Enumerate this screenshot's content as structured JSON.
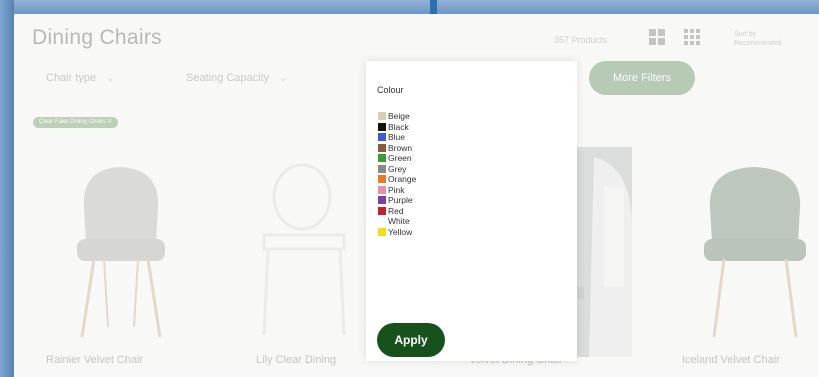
{
  "page": {
    "title": "Dining Chairs",
    "product_count": "357 Products",
    "sort_label": "Sort by Recommended"
  },
  "filters": {
    "chair_type": "Chair type",
    "seating_capacity": "Seating Capacity",
    "more_filters": "More Filters",
    "clear_tag": "Clear Fake Dining Chairs X"
  },
  "colour_panel": {
    "title": "Colour",
    "apply": "Apply",
    "options": [
      {
        "label": "Beige",
        "color": "#d8cfb8"
      },
      {
        "label": "Black",
        "color": "#111111"
      },
      {
        "label": "Blue",
        "color": "#3a5fcd"
      },
      {
        "label": "Brown",
        "color": "#8b5a3c"
      },
      {
        "label": "Green",
        "color": "#3a9a3a"
      },
      {
        "label": "Grey",
        "color": "#888888"
      },
      {
        "label": "Orange",
        "color": "#e8782a"
      },
      {
        "label": "Pink",
        "color": "#e68fb0"
      },
      {
        "label": "Purple",
        "color": "#7b3fa0"
      },
      {
        "label": "Red",
        "color": "#c8202a"
      },
      {
        "label": "White",
        "color": "#ffffff"
      },
      {
        "label": "Yellow",
        "color": "#f2dc1c"
      }
    ]
  },
  "products": [
    {
      "name": "Rainier Velvet Chair"
    },
    {
      "name": "Lily Clear Dining"
    },
    {
      "name": "Velvet Dining Chair"
    },
    {
      "name": "Iceland Velvet Chair"
    }
  ],
  "colors": {
    "accent_green": "#2e6b2a",
    "apply_green": "#17521d"
  }
}
